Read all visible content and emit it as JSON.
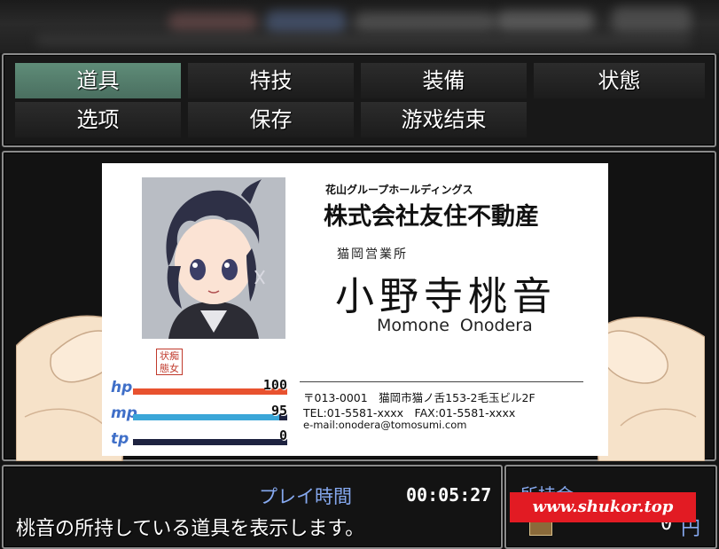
{
  "menu": {
    "commands": [
      {
        "label": "道具",
        "selected": true
      },
      {
        "label": "特技",
        "selected": false
      },
      {
        "label": "装備",
        "selected": false
      },
      {
        "label": "状態",
        "selected": false
      },
      {
        "label": "选项",
        "selected": false
      },
      {
        "label": "保存",
        "selected": false
      },
      {
        "label": "游戏结束",
        "selected": false
      }
    ]
  },
  "card": {
    "company_group": "花山グループホールディングス",
    "company_name": "株式会社友住不動産",
    "branch": "猫岡営業所",
    "name_kanji": "小野寺桃音",
    "name_romaji": "Momone Onodera",
    "address": "〒013-0001　猫岡市猫ノ舌153-2毛玉ビル2F",
    "phone_fax": "TEL:01-5581-xxxx　FAX:01-5581-xxxx",
    "email": "e-mail:onodera@tomosumi.com",
    "stamp": "状痴態女"
  },
  "gauges": {
    "hp": {
      "label": "hp",
      "value": "100",
      "rate": 1.0,
      "color": "#e8522f"
    },
    "mp": {
      "label": "mp",
      "value": "95",
      "rate": 0.95,
      "color": "#3aa6d8"
    },
    "tp": {
      "label": "tp",
      "value": "0",
      "rate": 0.0,
      "color": "#3cc45a"
    }
  },
  "help": {
    "playtime_label": "プレイ時間",
    "playtime_value": "00:05:27",
    "text": "桃音の所持している道具を表示します。"
  },
  "gold": {
    "label": "所持金",
    "value": "0",
    "unit": "円"
  },
  "watermark": "www.shukor.top",
  "colors": {
    "accent_blue": "#86a9f0",
    "selected_command": "#5f8c78"
  }
}
